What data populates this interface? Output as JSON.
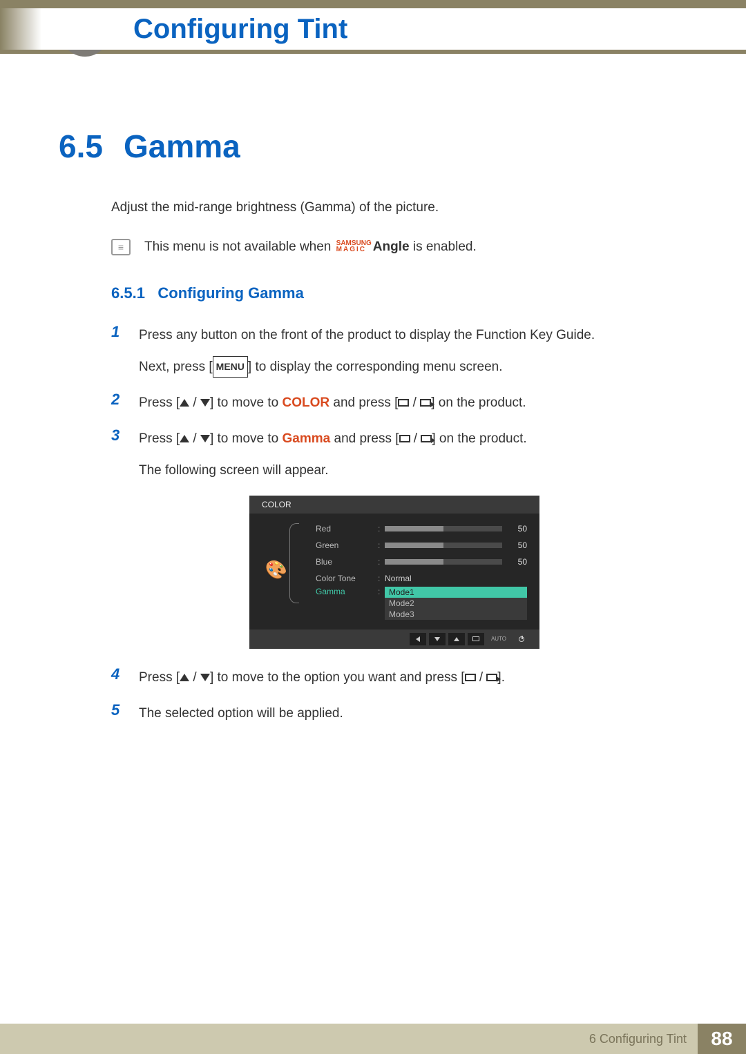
{
  "header": {
    "chapter_title": "Configuring Tint"
  },
  "section": {
    "number": "6.5",
    "name": "Gamma",
    "intro": "Adjust the mid-range brightness (Gamma) of the picture."
  },
  "note": {
    "prefix": "This menu is not available when ",
    "brand_top": "SAMSUNG",
    "brand_bottom": "MAGIC",
    "brand_word": "Angle",
    "suffix": " is enabled."
  },
  "subsection": {
    "number": "6.5.1",
    "name": "Configuring Gamma"
  },
  "steps": {
    "s1_num": "1",
    "s1_a": "Press any button on the front of the product to display the Function Key Guide.",
    "s1_b_pre": "Next, press [",
    "s1_b_menu": "MENU",
    "s1_b_post": "] to display the corresponding menu screen.",
    "s2_num": "2",
    "s2_pre": "Press [",
    "s2_mid": "] to move to ",
    "s2_kw": "COLOR",
    "s2_post1": " and press [",
    "s2_post2": "] on the product.",
    "s3_num": "3",
    "s3_pre": "Press [",
    "s3_mid": "] to move to ",
    "s3_kw": "Gamma",
    "s3_post1": " and press [",
    "s3_post2": "] on the product.",
    "s3_tail": "The following screen will appear.",
    "s4_num": "4",
    "s4_pre": "Press [",
    "s4_mid": "] to move to the option you want and press [",
    "s4_post": "].",
    "s5_num": "5",
    "s5_text": "The selected option will be applied."
  },
  "osd": {
    "title": "COLOR",
    "rows": {
      "red": {
        "label": "Red",
        "value": "50"
      },
      "green": {
        "label": "Green",
        "value": "50"
      },
      "blue": {
        "label": "Blue",
        "value": "50"
      },
      "tone": {
        "label": "Color Tone",
        "value": "Normal"
      },
      "gamma": {
        "label": "Gamma"
      }
    },
    "gamma_options": {
      "o1": "Mode1",
      "o2": "Mode2",
      "o3": "Mode3"
    },
    "nav_auto": "AUTO"
  },
  "footer": {
    "chapter": "6 Configuring Tint",
    "page": "88"
  }
}
